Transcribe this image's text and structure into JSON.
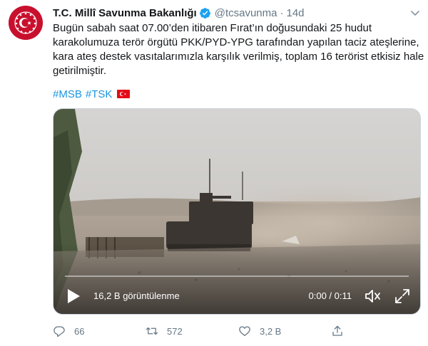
{
  "account": {
    "name": "T.C. Millî Savunma Bakanlığı",
    "handle": "@tcsavunma",
    "separator": "·",
    "time": "14d",
    "verified": true
  },
  "tweet": {
    "lines": [
      "Bugün sabah saat 07.00’den itibaren Fırat’ın doğusundaki 25 hudut",
      "karakolumuza terör örgütü PKK/PYD-YPG tarafından yapılan taciz ateşlerine,",
      "kara ateş destek vasıtalarımızla karşılık verilmiş, toplam 16 terörist etkisiz hale",
      "getirilmiştir."
    ],
    "hashtags": [
      "#MSB",
      "#TSK"
    ],
    "flag": "turkey-flag"
  },
  "video": {
    "views": "16,2 B görüntülenme",
    "time": "0:00 / 0:11",
    "progress": 0
  },
  "actions": {
    "reply_count": "66",
    "retweet_count": "572",
    "like_count": "3,2 B"
  },
  "icons": {
    "verified": "verified-badge-icon",
    "caret": "chevron-down-icon",
    "play": "play-icon",
    "volume": "volume-icon",
    "fullscreen": "fullscreen-icon",
    "reply": "reply-icon",
    "retweet": "retweet-icon",
    "like": "heart-icon",
    "share": "share-icon"
  },
  "colors": {
    "link": "#1b95e0",
    "muted": "#657786",
    "verified": "#1da1f2",
    "brand_red": "#c8102e"
  }
}
